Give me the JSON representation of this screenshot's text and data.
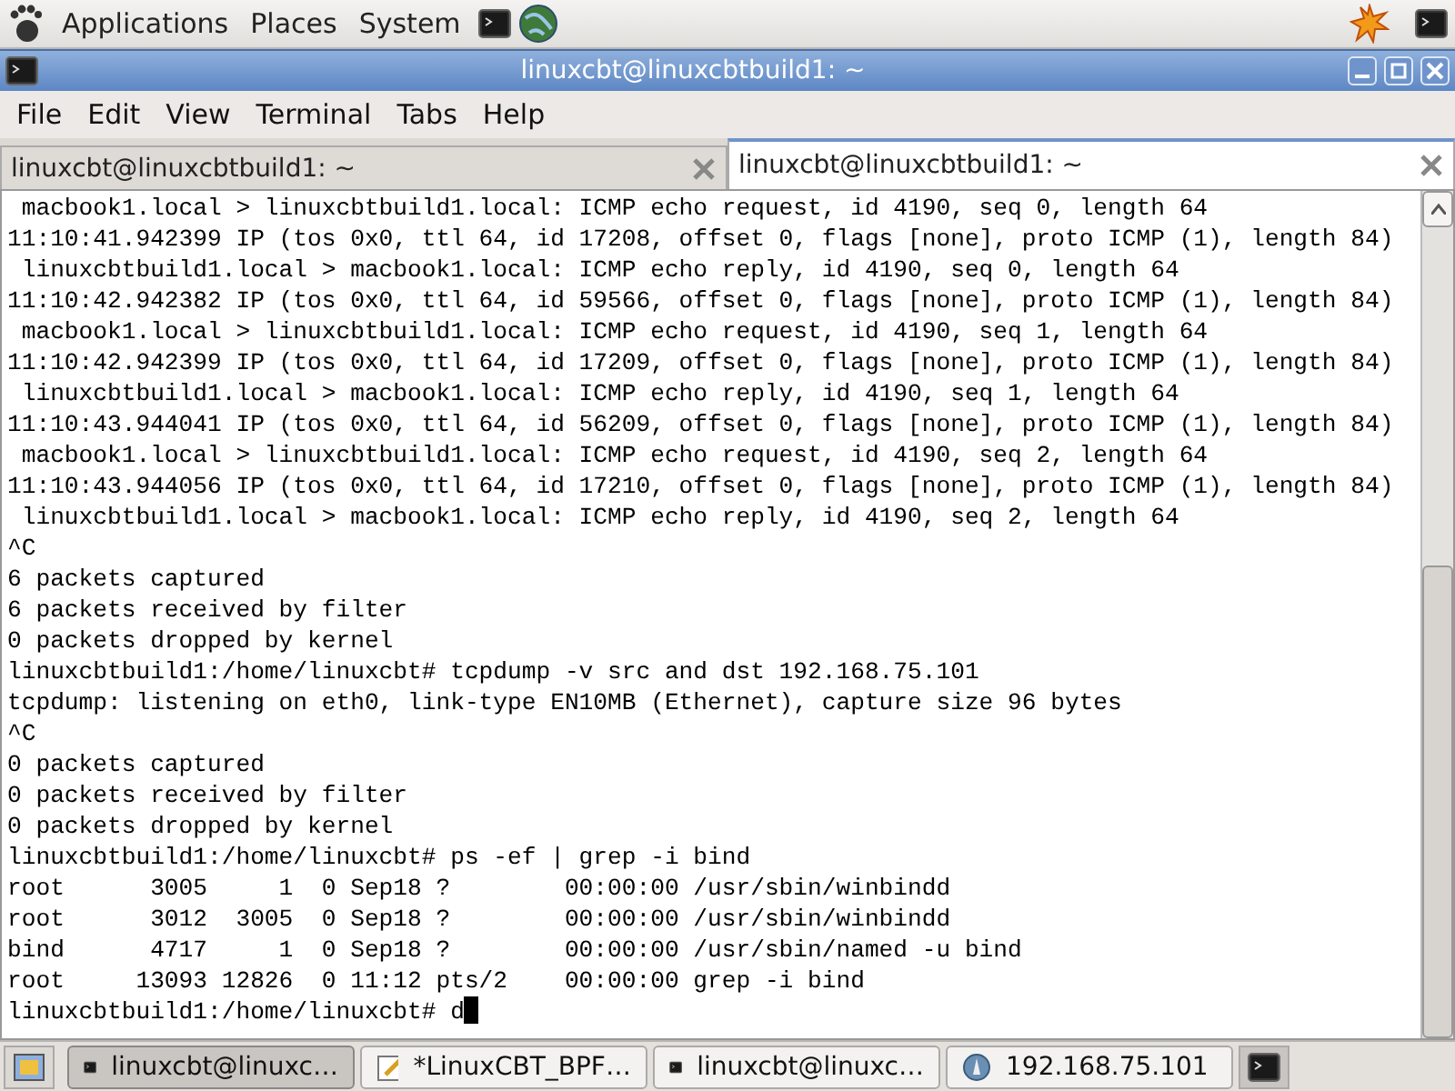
{
  "top_panel": {
    "menus": [
      "Applications",
      "Places",
      "System"
    ]
  },
  "window": {
    "title": "linuxcbt@linuxcbtbuild1: ~"
  },
  "menu_bar": [
    "File",
    "Edit",
    "View",
    "Terminal",
    "Tabs",
    "Help"
  ],
  "tabs": [
    {
      "label": "linuxcbt@linuxcbtbuild1: ~",
      "selected": false
    },
    {
      "label": "linuxcbt@linuxcbtbuild1: ~",
      "selected": true
    }
  ],
  "terminal": {
    "lines": [
      " macbook1.local > linuxcbtbuild1.local: ICMP echo request, id 4190, seq 0, length 64",
      "11:10:41.942399 IP (tos 0x0, ttl 64, id 17208, offset 0, flags [none], proto ICMP (1), length 84)",
      " linuxcbtbuild1.local > macbook1.local: ICMP echo reply, id 4190, seq 0, length 64",
      "11:10:42.942382 IP (tos 0x0, ttl 64, id 59566, offset 0, flags [none], proto ICMP (1), length 84)",
      " macbook1.local > linuxcbtbuild1.local: ICMP echo request, id 4190, seq 1, length 64",
      "11:10:42.942399 IP (tos 0x0, ttl 64, id 17209, offset 0, flags [none], proto ICMP (1), length 84)",
      " linuxcbtbuild1.local > macbook1.local: ICMP echo reply, id 4190, seq 1, length 64",
      "11:10:43.944041 IP (tos 0x0, ttl 64, id 56209, offset 0, flags [none], proto ICMP (1), length 84)",
      " macbook1.local > linuxcbtbuild1.local: ICMP echo request, id 4190, seq 2, length 64",
      "11:10:43.944056 IP (tos 0x0, ttl 64, id 17210, offset 0, flags [none], proto ICMP (1), length 84)",
      " linuxcbtbuild1.local > macbook1.local: ICMP echo reply, id 4190, seq 2, length 64",
      "^C",
      "6 packets captured",
      "6 packets received by filter",
      "0 packets dropped by kernel",
      "linuxcbtbuild1:/home/linuxcbt# tcpdump -v src and dst 192.168.75.101",
      "tcpdump: listening on eth0, link-type EN10MB (Ethernet), capture size 96 bytes",
      "^C",
      "0 packets captured",
      "0 packets received by filter",
      "0 packets dropped by kernel",
      "linuxcbtbuild1:/home/linuxcbt# ps -ef | grep -i bind",
      "root      3005     1  0 Sep18 ?        00:00:00 /usr/sbin/winbindd",
      "root      3012  3005  0 Sep18 ?        00:00:00 /usr/sbin/winbindd",
      "bind      4717     1  0 Sep18 ?        00:00:00 /usr/sbin/named -u bind",
      "root     13093 12826  0 11:12 pts/2    00:00:00 grep -i bind",
      "linuxcbtbuild1:/home/linuxcbt# d"
    ]
  },
  "taskbar": [
    {
      "kind": "terminal",
      "label": "linuxcbt@linuxc…",
      "selected": true
    },
    {
      "kind": "editor",
      "label": "*LinuxCBT_BPF…",
      "selected": false
    },
    {
      "kind": "terminal",
      "label": "linuxcbt@linuxc…",
      "selected": false
    },
    {
      "kind": "browser",
      "label": "192.168.75.101",
      "selected": false
    }
  ]
}
